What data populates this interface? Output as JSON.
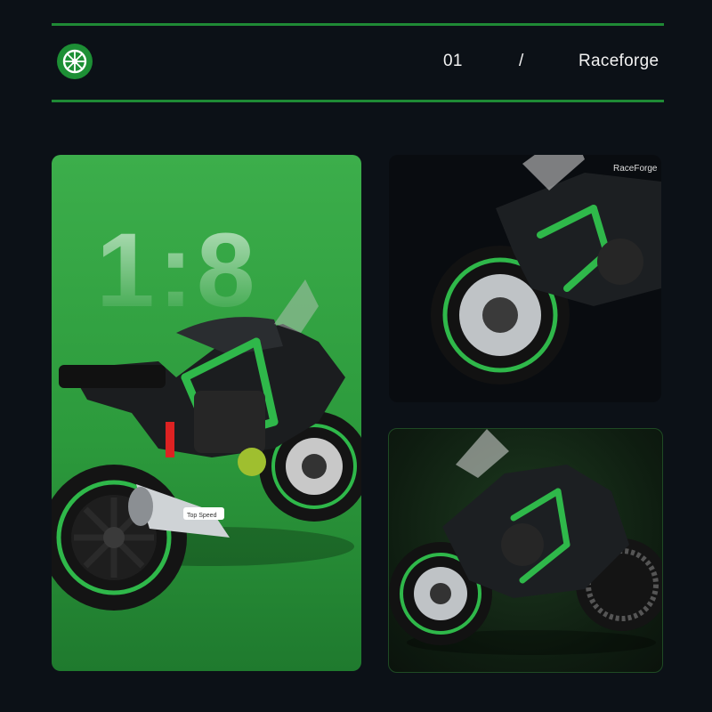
{
  "header": {
    "logo_icon": "wheel-icon",
    "number": "01",
    "separator": "/",
    "brand": "Raceforge"
  },
  "panels": {
    "scale_text": "1:8",
    "top_speed_label": "Top Speed",
    "fairing_brand": "RaceForge"
  },
  "colors": {
    "accent": "#1f8a35",
    "background": "#0c1117",
    "panel_green": "#35a645"
  }
}
